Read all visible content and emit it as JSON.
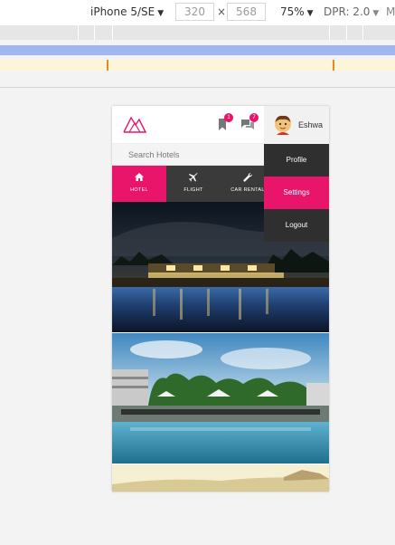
{
  "devtools": {
    "device": "iPhone 5/SE",
    "width": "320",
    "x": "×",
    "height": "568",
    "zoom": "75%",
    "dpr": "DPR: 2.0",
    "more": "M"
  },
  "app": {
    "user_name": "Eshwa",
    "bookmark_badge": "1",
    "message_badge": "7",
    "search": {
      "placeholder": "Search Hotels"
    },
    "tabs": [
      {
        "label": "HOTEL",
        "icon": "home-icon"
      },
      {
        "label": "FLIGHT",
        "icon": "plane-icon"
      },
      {
        "label": "CAR RENTAL",
        "icon": "wrench-icon"
      }
    ],
    "dropdown": {
      "items": [
        {
          "label": "Profile"
        },
        {
          "label": "Settings"
        },
        {
          "label": "Logout"
        }
      ]
    },
    "colors": {
      "accent": "#e8156b",
      "nav_dark": "#3a3a3a",
      "menu_dark": "#2f2f2f"
    }
  }
}
